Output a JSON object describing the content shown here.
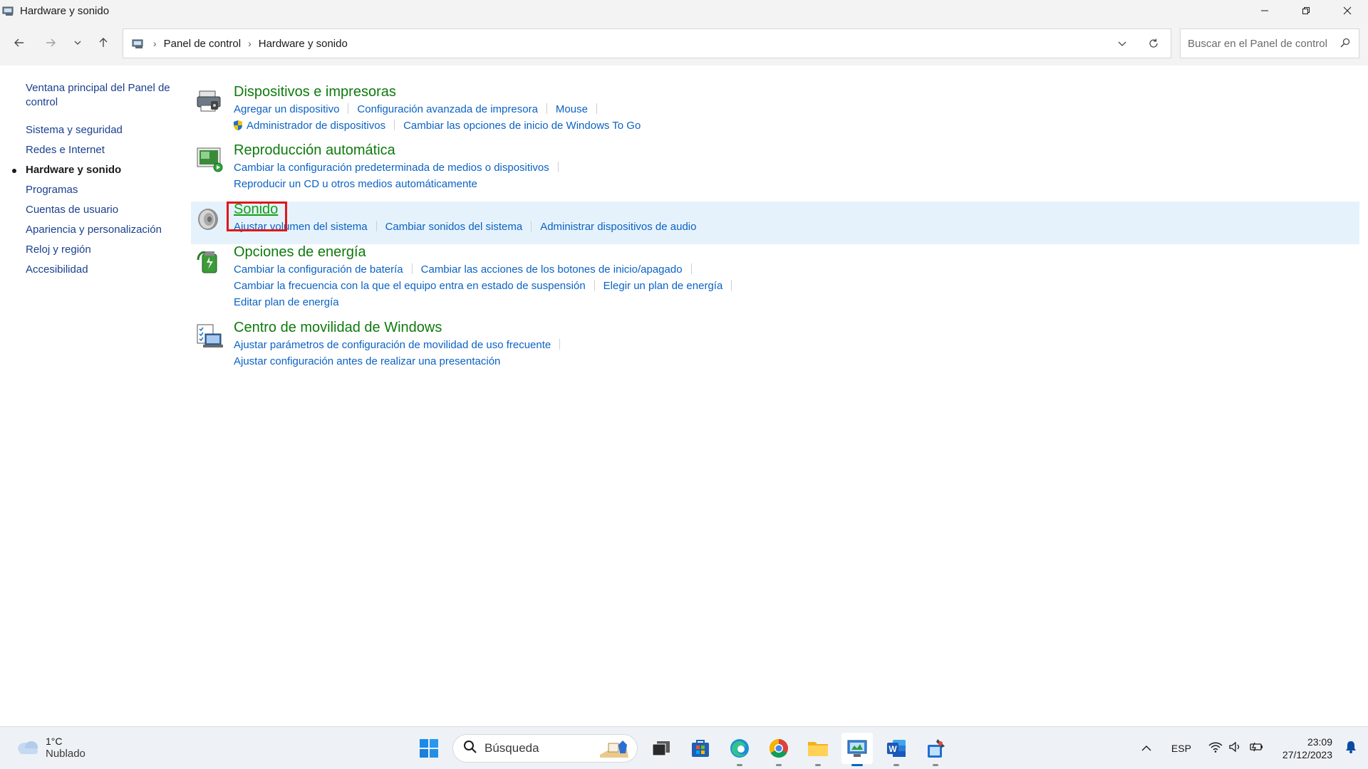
{
  "window": {
    "title": "Hardware y sonido",
    "controls": {
      "minimize": "—",
      "restore": "❐",
      "close": "✕"
    }
  },
  "address_bar": {
    "crumbs": [
      "Panel de control",
      "Hardware y sonido"
    ],
    "search_placeholder": "Buscar en el Panel de control"
  },
  "sidebar": {
    "home": "Ventana principal del Panel de control",
    "items": [
      {
        "label": "Sistema y seguridad",
        "current": false
      },
      {
        "label": "Redes e Internet",
        "current": false
      },
      {
        "label": "Hardware y sonido",
        "current": true
      },
      {
        "label": "Programas",
        "current": false
      },
      {
        "label": "Cuentas de usuario",
        "current": false
      },
      {
        "label": "Apariencia y personalización",
        "current": false
      },
      {
        "label": "Reloj y región",
        "current": false
      },
      {
        "label": "Accesibilidad",
        "current": false
      }
    ]
  },
  "categories": {
    "devices": {
      "title": "Dispositivos e impresoras",
      "links": [
        "Agregar un dispositivo",
        "Configuración avanzada de impresora",
        "Mouse",
        "Administrador de dispositivos",
        "Cambiar las opciones de inicio de Windows To Go"
      ]
    },
    "autoplay": {
      "title": "Reproducción automática",
      "links": [
        "Cambiar la configuración predeterminada de medios o dispositivos",
        "Reproducir un CD u otros medios automáticamente"
      ]
    },
    "sound": {
      "title": "Sonido",
      "links": [
        "Ajustar volumen del sistema",
        "Cambiar sonidos del sistema",
        "Administrar dispositivos de audio"
      ]
    },
    "power": {
      "title": "Opciones de energía",
      "links": [
        "Cambiar la configuración de batería",
        "Cambiar las acciones de los botones de inicio/apagado",
        "Cambiar la frecuencia con la que el equipo entra en estado de suspensión",
        "Elegir un plan de energía",
        "Editar plan de energía"
      ]
    },
    "mobility": {
      "title": "Centro de movilidad de Windows",
      "links": [
        "Ajustar parámetros de configuración de movilidad de uso frecuente",
        "Ajustar configuración antes de realizar una presentación"
      ]
    }
  },
  "taskbar": {
    "weather_temp": "1°C",
    "weather_cond": "Nublado",
    "search_label": "Búsqueda",
    "lang": "ESP",
    "time": "23:09",
    "date": "27/12/2023"
  },
  "colors": {
    "category_title": "#0e7a0d",
    "link": "#0b62c4",
    "highlight": "#e0161b",
    "selected_row": "#e6f2fb"
  }
}
